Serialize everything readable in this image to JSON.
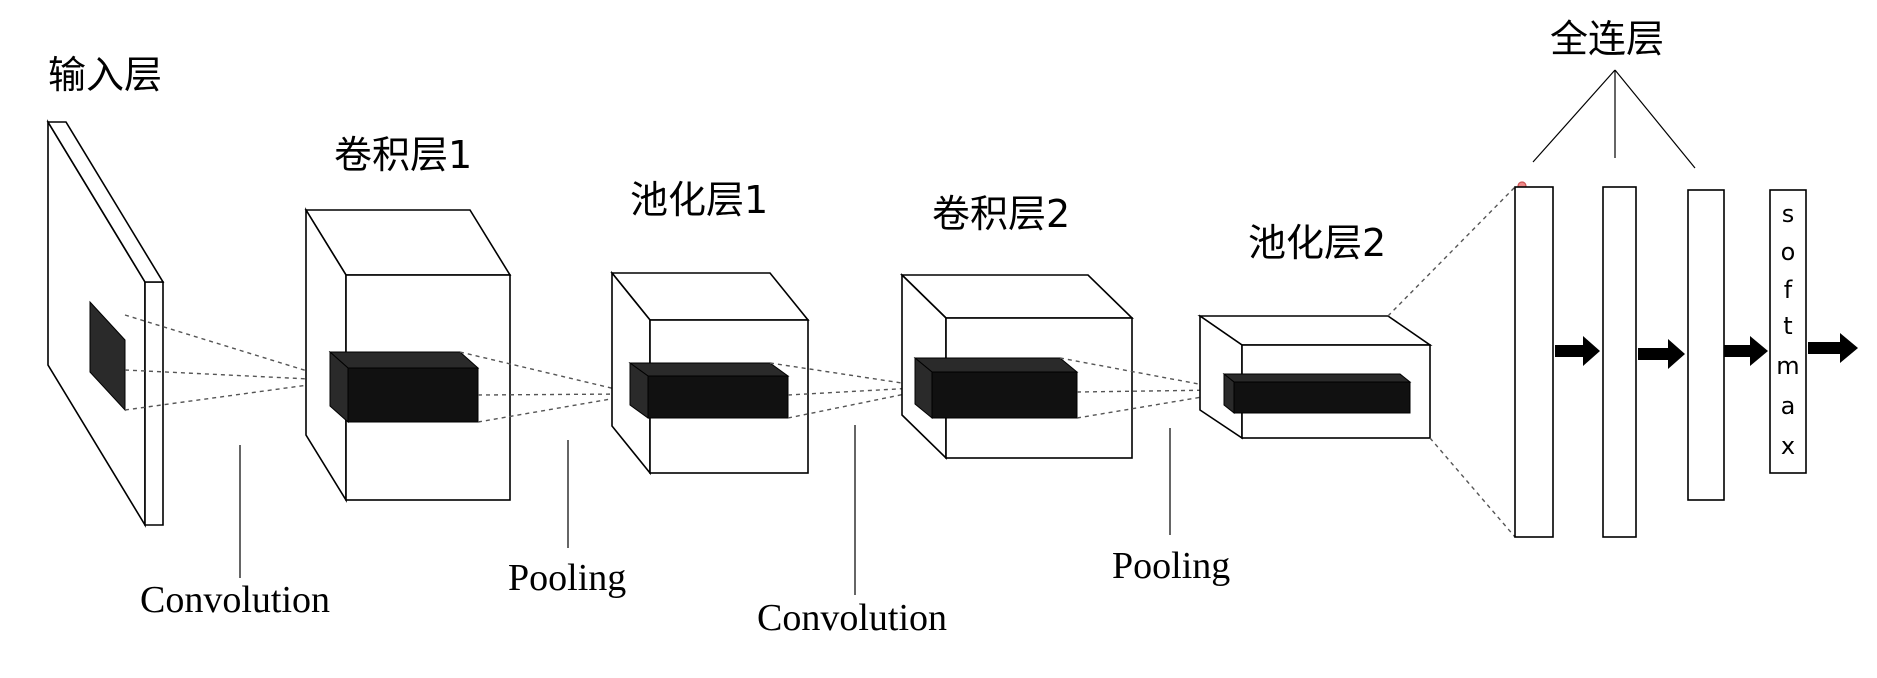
{
  "labels": {
    "input_layer": "输入层",
    "conv_layer_1": "卷积层1",
    "pool_layer_1": "池化层1",
    "conv_layer_2": "卷积层2",
    "pool_layer_2": "池化层2",
    "fc_layer": "全连层",
    "op_convolution_1": "Convolution",
    "op_pooling_1": "Pooling",
    "op_convolution_2": "Convolution",
    "op_pooling_2": "Pooling",
    "softmax_letters": [
      "s",
      "o",
      "f",
      "t",
      "m",
      "a",
      "x"
    ]
  }
}
